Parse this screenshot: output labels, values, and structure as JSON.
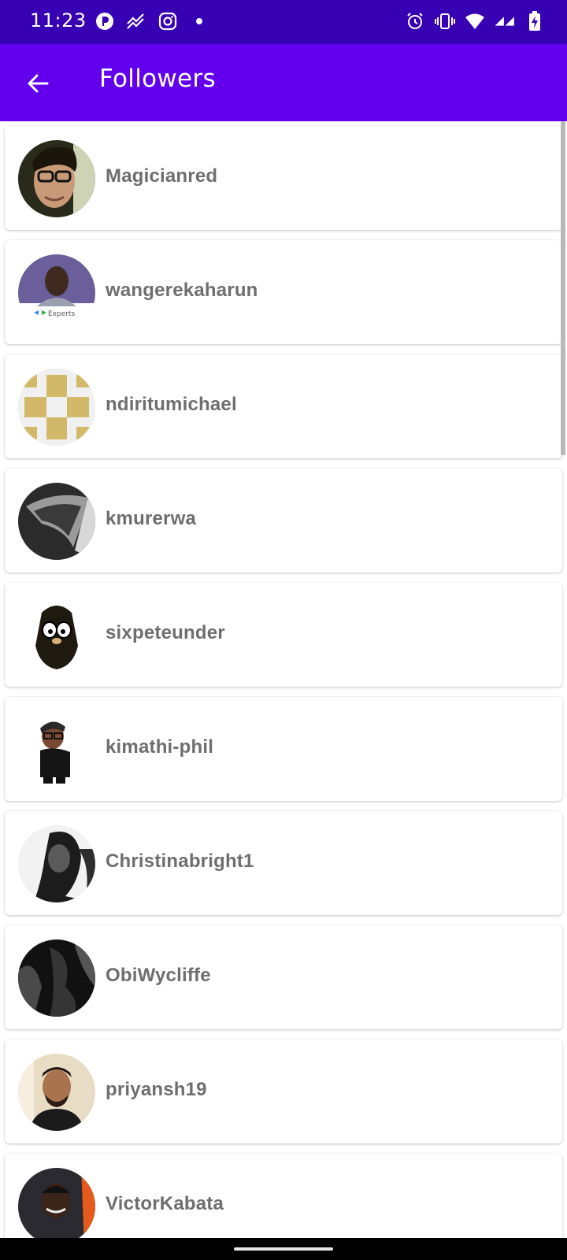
{
  "status_bar": {
    "time": "11:23",
    "left_icons": [
      "notification-app-icon",
      "trend-icon",
      "instagram-icon",
      "dot-icon"
    ],
    "right_icons": [
      "alarm-icon",
      "vibrate-icon",
      "wifi-icon",
      "signal-icon",
      "battery-charging-icon"
    ]
  },
  "app_bar": {
    "title": "Followers",
    "back_icon": "arrow-left-icon",
    "background": "#6200ee",
    "status_background": "#3700b3"
  },
  "followers": [
    {
      "username": "Magicianred"
    },
    {
      "username": "wangerekaharun"
    },
    {
      "username": "ndiritumichael"
    },
    {
      "username": "kmurerwa"
    },
    {
      "username": "sixpeteunder"
    },
    {
      "username": "kimathi-phil"
    },
    {
      "username": "Christinabright1"
    },
    {
      "username": "ObiWycliffe"
    },
    {
      "username": "priyansh19"
    },
    {
      "username": "VictorKabata"
    }
  ]
}
